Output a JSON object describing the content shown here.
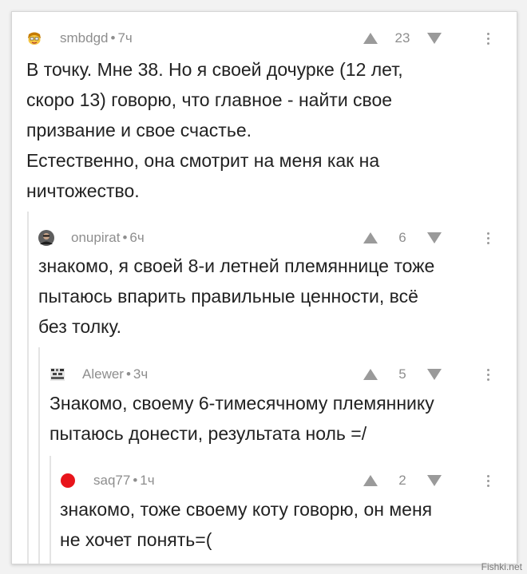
{
  "comments": [
    {
      "author": "smbdgd",
      "time": "7ч",
      "score": "23",
      "text": "В точку. Мне 38. Но я своей дочурке (12 лет,\nскоро 13) говорю, что главное - найти свое\nпризвание и свое счастье.\nЕстественно, она смотрит на меня как на\nничтожество.",
      "avatar_icon": "cartoon-face-avatar-icon",
      "avatar_color": "#f0b400"
    },
    {
      "author": "onupirat",
      "time": "6ч",
      "score": "6",
      "text": "знакомо, я своей 8-и летней племяннице тоже\nпытаюсь впарить правильные ценности, всё\nбез толку.",
      "avatar_icon": "person-photo-avatar-icon",
      "avatar_color": "#3a3a3a"
    },
    {
      "author": "Alewer",
      "time": "3ч",
      "score": "5",
      "text": "Знакомо, своему 6-тимесячному племяннику\nпытаюсь донести, результата ноль =/",
      "avatar_icon": "pixel-avatar-icon",
      "avatar_color": "#555555"
    },
    {
      "author": "saq77",
      "time": "1ч",
      "score": "2",
      "text": "знакомо, тоже своему коту говорю, он меня\nне хочет понять=(",
      "avatar_icon": "red-circle-avatar-icon",
      "avatar_color": "#e8141b"
    }
  ],
  "meta_separator": "•",
  "watermark": "Fishki.net",
  "colors": {
    "text": "#222222",
    "meta": "#8e8e8e",
    "vote_arrow": "#9a9a9a",
    "thread_line": "#e4e4e4"
  }
}
